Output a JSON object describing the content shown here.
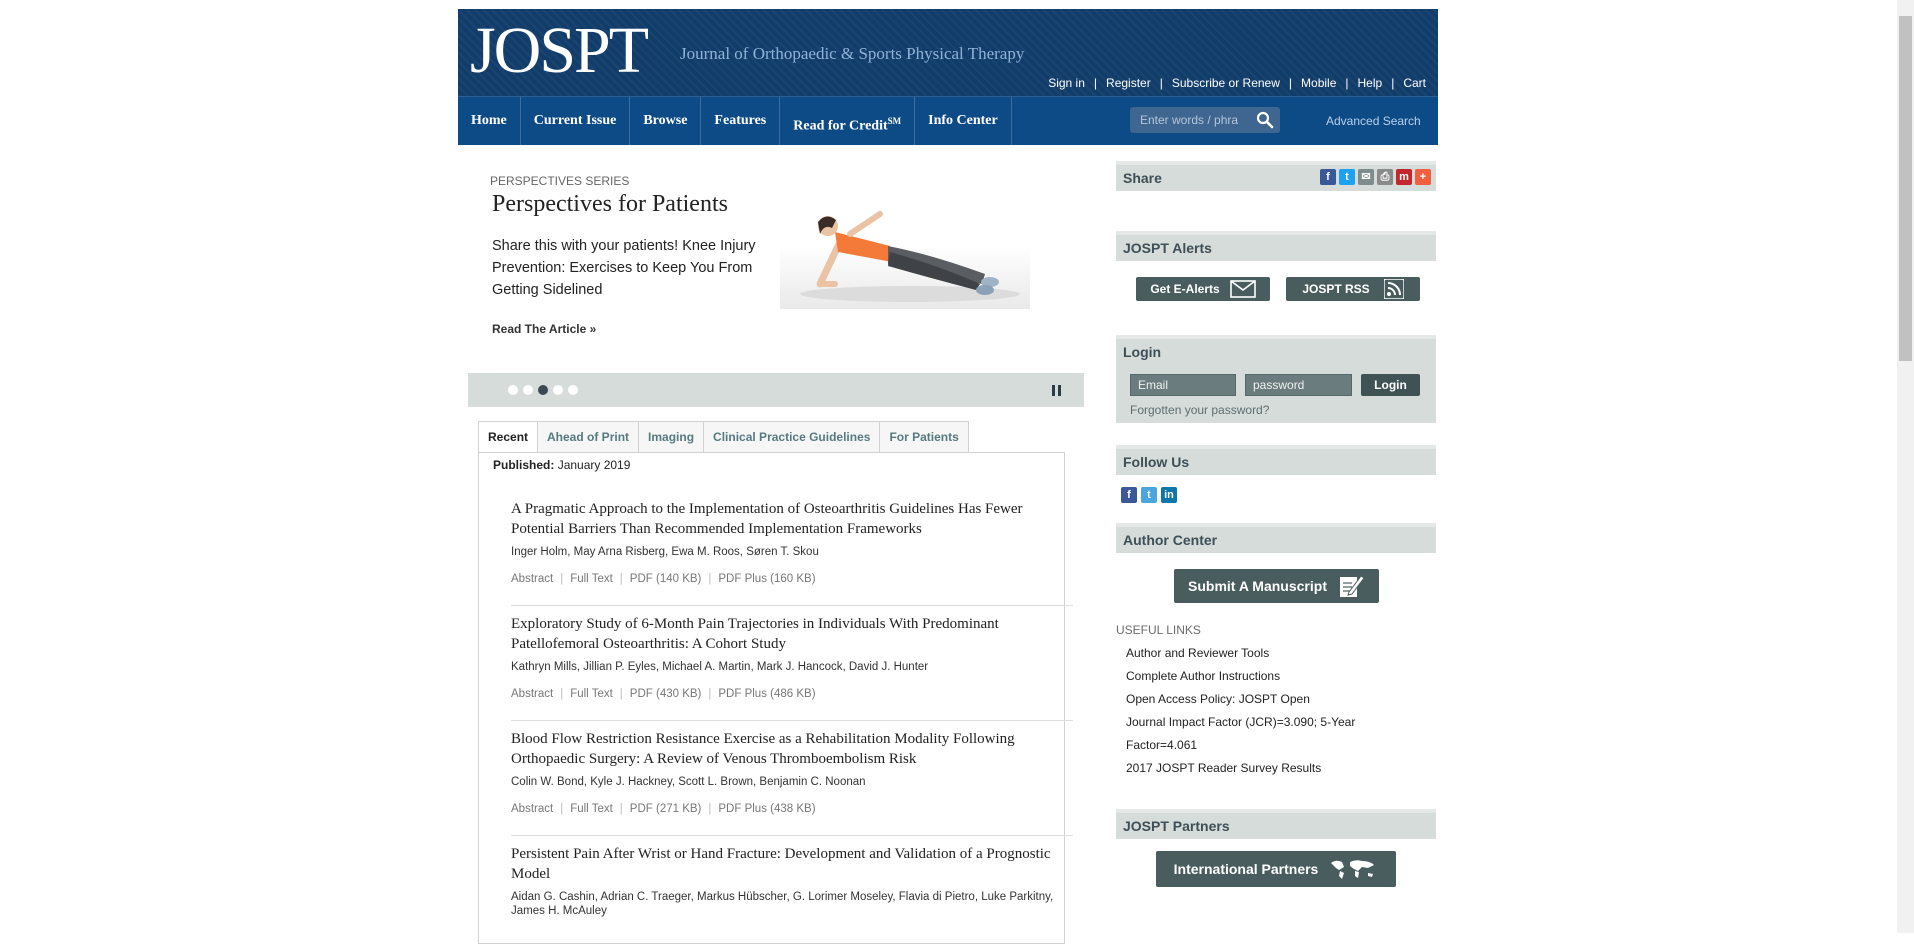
{
  "header": {
    "logo": "JOSPT",
    "tagline": "Journal of Orthopaedic & Sports Physical Therapy",
    "top_links": [
      "Sign in",
      "Register",
      "Subscribe or Renew",
      "Mobile",
      "Help",
      "Cart"
    ],
    "separator": "|"
  },
  "nav": {
    "items": [
      "Home",
      "Current Issue",
      "Browse",
      "Features"
    ],
    "read_for_credit": "Read for Credit",
    "read_for_credit_sup": "SM",
    "info_center": "Info Center",
    "search_placeholder": "Enter words / phrases",
    "advanced_search": "Advanced Search"
  },
  "hero": {
    "kicker": "PERSPECTIVES SERIES",
    "title": "Perspectives for Patients",
    "text": "Share this with your patients! Knee Injury Prevention: Exercises to Keep You From Getting Sidelined",
    "link": "Read The Article »",
    "slides": 5,
    "active_slide": 3
  },
  "tabs": [
    "Recent",
    "Ahead of Print",
    "Imaging",
    "Clinical Practice Guidelines",
    "For Patients"
  ],
  "published": {
    "label": "Published:",
    "value": "January 2019"
  },
  "articles": [
    {
      "title": "A Pragmatic Approach to the Implementation of Osteoarthritis Guidelines Has Fewer Potential Barriers Than Recommended Implementation Frameworks",
      "authors": "Inger Holm, May Arna Risberg, Ewa M. Roos, Søren T. Skou",
      "links": [
        "Abstract",
        "Full Text",
        "PDF (140 KB)",
        "PDF Plus (160 KB)"
      ]
    },
    {
      "title": "Exploratory Study of 6-Month Pain Trajectories in Individuals With Predominant Patellofemoral Osteoarthritis: A Cohort Study",
      "authors": "Kathryn Mills, Jillian P. Eyles, Michael A. Martin, Mark J. Hancock, David J. Hunter",
      "links": [
        "Abstract",
        "Full Text",
        "PDF (430 KB)",
        "PDF Plus (486 KB)"
      ]
    },
    {
      "title": "Blood Flow Restriction Resistance Exercise as a Rehabilitation Modality Following Orthopaedic Surgery: A Review of Venous Thromboembolism Risk",
      "authors": "Colin W. Bond, Kyle J. Hackney, Scott L. Brown, Benjamin C. Noonan",
      "links": [
        "Abstract",
        "Full Text",
        "PDF (271 KB)",
        "PDF Plus (438 KB)"
      ]
    },
    {
      "title": "Persistent Pain After Wrist or Hand Fracture: Development and Validation of a Prognostic Model",
      "authors": "Aidan G. Cashin, Adrian C. Traeger, Markus Hübscher, G. Lorimer Moseley, Flavia di Pietro, Luke Parkitny, James H. McAuley"
    }
  ],
  "sidebar": {
    "share": "Share",
    "alerts": {
      "title": "JOSPT Alerts",
      "e_alerts": "Get E-Alerts",
      "rss": "JOSPT RSS"
    },
    "login": {
      "title": "Login",
      "email_placeholder": "Email",
      "password_placeholder": "password",
      "button": "Login",
      "forgot": "Forgotten your password?"
    },
    "follow": "Follow Us",
    "author_center": {
      "title": "Author Center",
      "submit": "Submit A Manuscript"
    },
    "useful_links": {
      "title": "USEFUL LINKS",
      "items": [
        "Author and Reviewer Tools",
        "Complete Author Instructions",
        "Open Access Policy: JOSPT Open",
        "Journal Impact Factor (JCR)=3.090; 5-Year",
        "Factor=4.061",
        "2017 JOSPT Reader Survey Results"
      ]
    },
    "partners": {
      "title": "JOSPT Partners",
      "international": "International Partners"
    }
  },
  "colors": {
    "header_bg": "#123d6b",
    "nav_bg": "#0d4b87",
    "sidebar_head": "#d5dcd9",
    "button": "#495d5f"
  }
}
